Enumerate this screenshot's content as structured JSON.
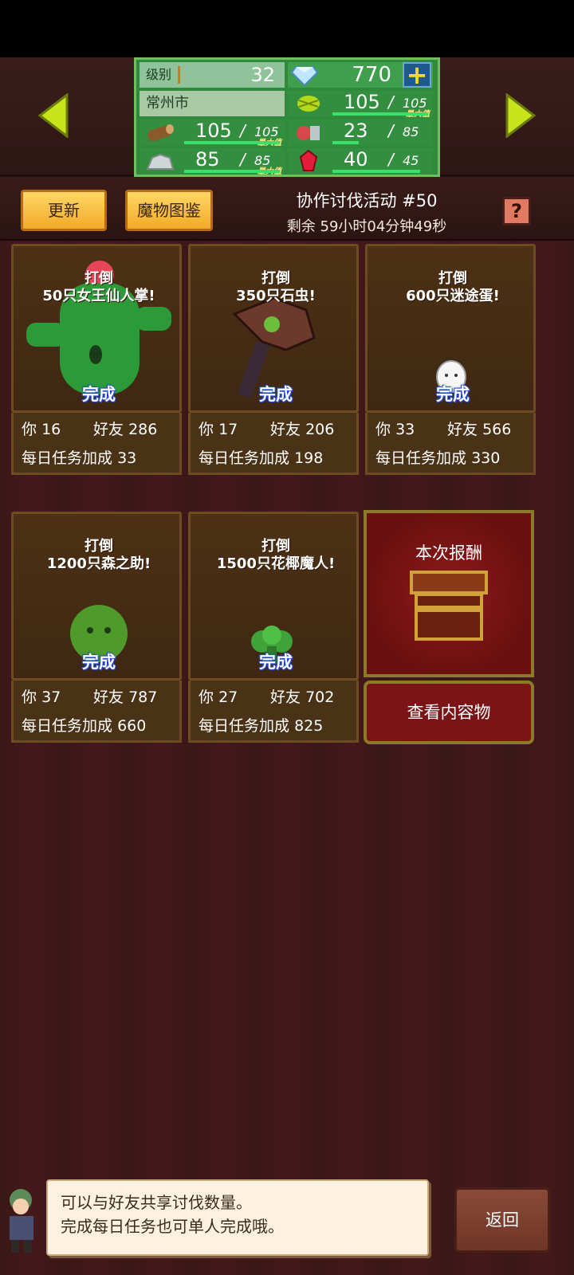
{
  "header": {
    "level_label": "级别",
    "level_value": "32",
    "gems": "770",
    "plus_icon": "plus-icon",
    "city": "常州市",
    "resources": [
      {
        "icon": "wood-icon",
        "value": "105",
        "max": "105",
        "max_tag": "最大值",
        "fill": 1.0
      },
      {
        "icon": "grain-icon",
        "value": "105",
        "max": "105",
        "max_tag": "最大值",
        "fill": 1.0
      },
      {
        "icon": "ore-icon",
        "value": "85",
        "max": "85",
        "max_tag": "最大值",
        "fill": 1.0
      },
      {
        "icon": "meat-icon",
        "value": "23",
        "max": "85",
        "max_tag": "",
        "fill": 0.27
      },
      {
        "icon": "ruby-icon",
        "value": "40",
        "max": "45",
        "max_tag": "",
        "fill": 0.89
      }
    ]
  },
  "toolbar": {
    "refresh_label": "更新",
    "dex_label": "魔物图鉴",
    "event_title": "协作讨伐活动 #50",
    "event_timer": "剩余 59小时04分钟49秒",
    "help_label": "?"
  },
  "cards": [
    {
      "task_line1": "打倒",
      "task_line2": "50只女王仙人掌!",
      "done": "完成",
      "you_label": "你",
      "you": "16",
      "friends_label": "好友",
      "friends": "286",
      "bonus_label": "每日任务加成",
      "bonus": "33"
    },
    {
      "task_line1": "打倒",
      "task_line2": "350只石虫!",
      "done": "完成",
      "you_label": "你",
      "you": "17",
      "friends_label": "好友",
      "friends": "206",
      "bonus_label": "每日任务加成",
      "bonus": "198"
    },
    {
      "task_line1": "打倒",
      "task_line2": "600只迷途蛋!",
      "done": "完成",
      "you_label": "你",
      "you": "33",
      "friends_label": "好友",
      "friends": "566",
      "bonus_label": "每日任务加成",
      "bonus": "330"
    },
    {
      "task_line1": "打倒",
      "task_line2": "1200只森之助!",
      "done": "完成",
      "you_label": "你",
      "you": "37",
      "friends_label": "好友",
      "friends": "787",
      "bonus_label": "每日任务加成",
      "bonus": "660"
    },
    {
      "task_line1": "打倒",
      "task_line2": "1500只花椰魔人!",
      "done": "完成",
      "you_label": "你",
      "you": "27",
      "friends_label": "好友",
      "friends": "702",
      "bonus_label": "每日任务加成",
      "bonus": "825"
    }
  ],
  "reward": {
    "label": "本次报酬",
    "view_label": "查看内容物"
  },
  "bubble": {
    "line1": "可以与好友共享讨伐数量。",
    "line2": "完成每日任务也可单人完成哦。"
  },
  "back_label": "返回",
  "colors": {
    "accent_yellow": "#f2a928",
    "stats_green": "#2f8a3c",
    "reward_red": "#7a1416",
    "done_blue": "#1f48d8"
  }
}
